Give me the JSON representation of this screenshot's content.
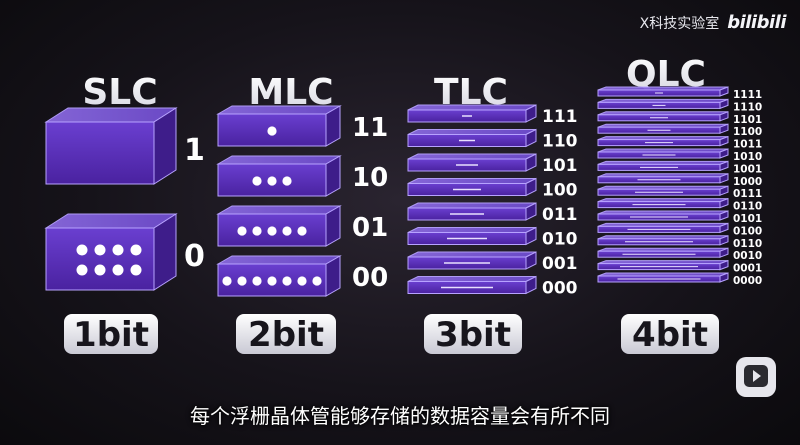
{
  "watermark": {
    "text": "X科技实验室",
    "brand": "bilibili"
  },
  "subtitle": "每个浮栅晶体管能够存储的数据容量会有所不同",
  "diagram": {
    "slc": {
      "title": "SLC",
      "bit_label": "1bit",
      "levels": [
        {
          "label": "1",
          "dots": 0
        },
        {
          "label": "0",
          "dots": 8
        }
      ]
    },
    "mlc": {
      "title": "MLC",
      "bit_label": "2bit",
      "levels": [
        {
          "label": "11",
          "dots": 1
        },
        {
          "label": "10",
          "dots": 3
        },
        {
          "label": "01",
          "dots": 5
        },
        {
          "label": "00",
          "dots": 7
        }
      ]
    },
    "tlc": {
      "title": "TLC",
      "bit_label": "3bit",
      "levels": [
        "111",
        "110",
        "101",
        "100",
        "011",
        "010",
        "001",
        "000"
      ]
    },
    "qlc": {
      "title": "QLC",
      "bit_label": "4bit",
      "levels": [
        "1111",
        "1110",
        "1101",
        "1100",
        "1011",
        "1010",
        "1001",
        "1000",
        "0111",
        "0110",
        "0101",
        "0100",
        "0110",
        "0010",
        "0001",
        "0000"
      ]
    }
  },
  "colors": {
    "box_face": "#5a2fb0",
    "box_top": "#7a55d6",
    "box_edge": "#b7a2ff",
    "dot": "#ffffff",
    "text": "#ffffff"
  }
}
